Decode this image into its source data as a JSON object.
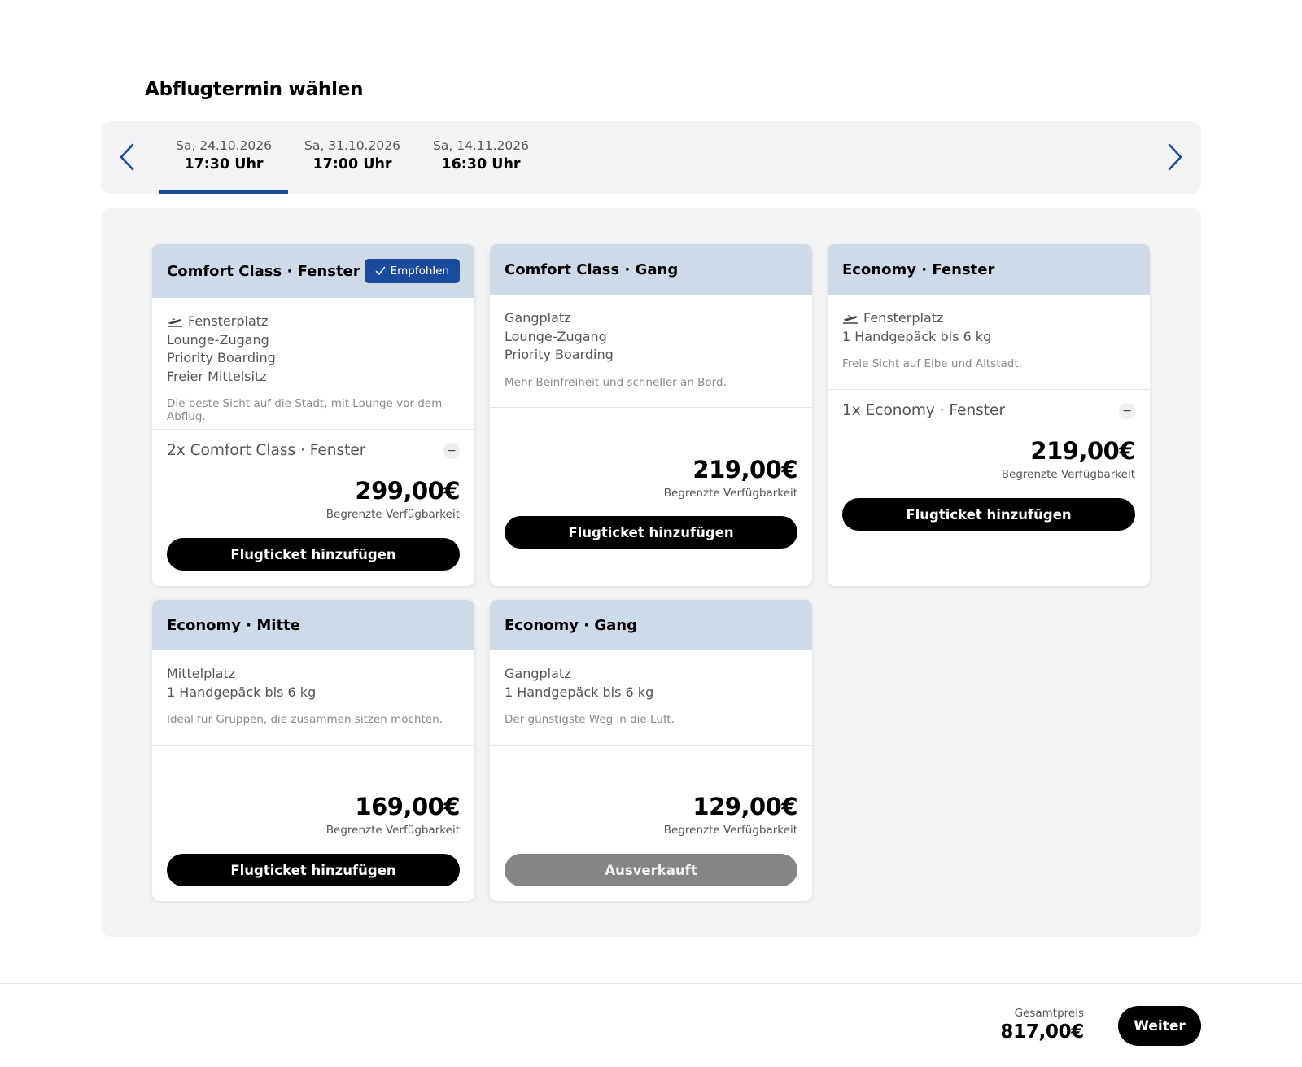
{
  "page": {
    "title": "Abflugtermin wählen"
  },
  "dates": [
    {
      "date": "Sa, 24.10.2026",
      "time": "17:30 Uhr",
      "active": true
    },
    {
      "date": "Sa, 31.10.2026",
      "time": "17:00 Uhr",
      "active": false
    },
    {
      "date": "Sa, 14.11.2026",
      "time": "16:30 Uhr",
      "active": false
    }
  ],
  "cards": [
    {
      "title": "Comfort Class · Fenster",
      "badge": "Empfohlen",
      "features": [
        "Fensterplatz",
        "Lounge-Zugang",
        "Priority Boarding",
        "Freier Mittelsitz"
      ],
      "note": "Die beste Sicht auf die Stadt, mit Lounge vor dem Abflug.",
      "qty_label": "2x Comfort Class · Fenster",
      "price": "299,00€",
      "availability": "Begrenzte Verfügbarkeit",
      "cta": "Flugticket hinzufügen"
    },
    {
      "title": "Comfort Class · Gang",
      "features": [
        "Gangplatz",
        "Lounge-Zugang",
        "Priority Boarding"
      ],
      "note": "Mehr Beinfreiheit und schneller an Bord.",
      "price": "219,00€",
      "availability": "Begrenzte Verfügbarkeit",
      "cta": "Flugticket hinzufügen"
    },
    {
      "title": "Economy · Fenster",
      "features": [
        "Fensterplatz",
        "1 Handgepäck bis 6 kg"
      ],
      "note": "Freie Sicht auf Elbe und Altstadt.",
      "qty_label": "1x Economy · Fenster",
      "price": "219,00€",
      "availability": "Begrenzte Verfügbarkeit",
      "cta": "Flugticket hinzufügen"
    },
    {
      "title": "Economy · Mitte",
      "features": [
        "Mittelplatz",
        "1 Handgepäck bis 6 kg"
      ],
      "note": "Ideal für Gruppen, die zusammen sitzen möchten.",
      "price": "169,00€",
      "availability": "Begrenzte Verfügbarkeit",
      "cta": "Flugticket hinzufügen"
    },
    {
      "title": "Economy · Gang",
      "features": [
        "Gangplatz",
        "1 Handgepäck bis 6 kg"
      ],
      "note": "Der günstigste Weg in die Luft.",
      "price": "129,00€",
      "availability": "Begrenzte Verfügbarkeit",
      "cta": "Ausverkauft"
    }
  ],
  "icons": {
    "window_seat": "plane-takeoff-icon",
    "prev": "chevron-left-icon",
    "next": "chevron-right-icon",
    "check": "check-icon",
    "minus": "minus-icon"
  },
  "colors": {
    "accent": "#1a4a9c",
    "card_header": "#cfdae9",
    "panel": "#f2f4f6",
    "disabled": "#858585"
  },
  "footer": {
    "total_label": "Gesamtpreis",
    "total_value": "817,00€",
    "next_label": "Weiter"
  }
}
